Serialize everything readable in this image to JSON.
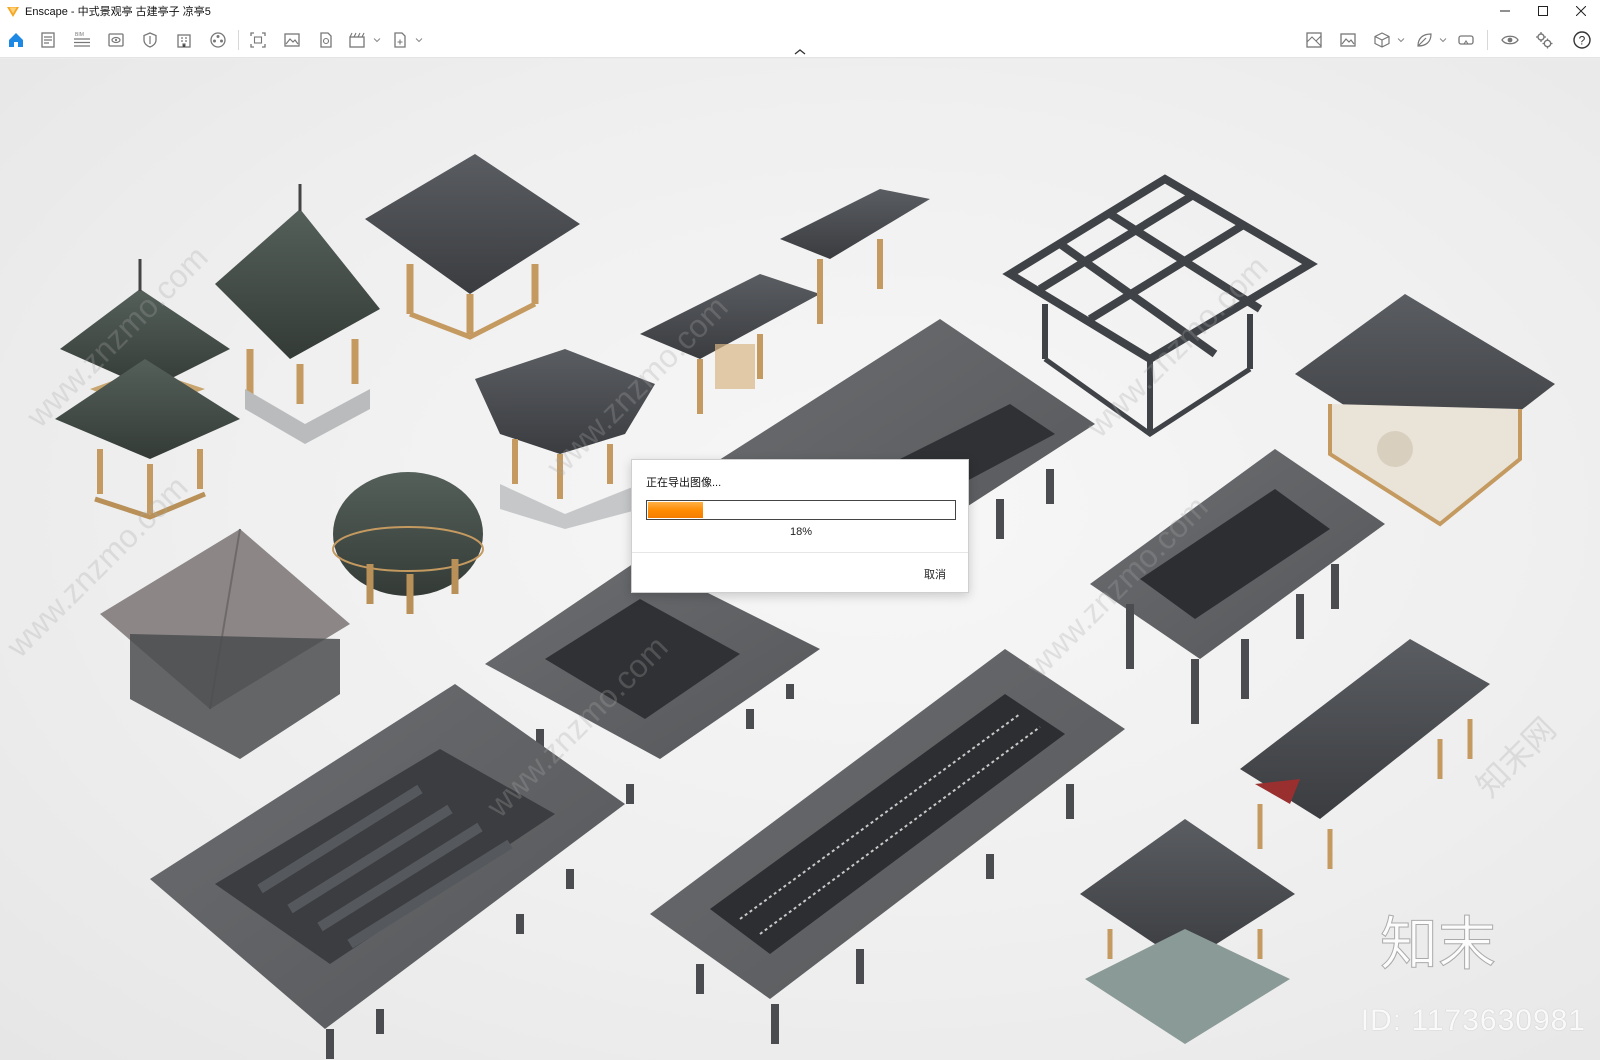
{
  "window": {
    "title": "Enscape - 中式景观亭 古建亭子 凉亭5",
    "minimize_symbol": "—",
    "maximize_symbol": "☐",
    "close_symbol": "✕"
  },
  "toolbar": {
    "left_icons": [
      "home-icon",
      "document-icon",
      "bim-icon",
      "view-icon",
      "shield-icon",
      "building-icon",
      "materials-icon"
    ],
    "right_icons": [
      "map-icon",
      "image-icon",
      "cube-icon",
      "leaf-icon",
      "vr-headset-icon",
      "eye-icon",
      "settings-icon",
      "help-icon"
    ],
    "help_symbol": "?"
  },
  "dialog": {
    "title": "正在导出图像...",
    "progress_percent": 18,
    "progress_label": "18%",
    "cancel_label": "取消"
  },
  "watermarks": {
    "site_text": "www.znzmo.com",
    "brand_prefix": "知末网",
    "logo_text": "知末",
    "id_text": "ID: 1173630981"
  },
  "colors": {
    "accent_blue": "#1e88e5",
    "progress_orange": "#ff8a00",
    "logo_orange": "#f5a623"
  }
}
